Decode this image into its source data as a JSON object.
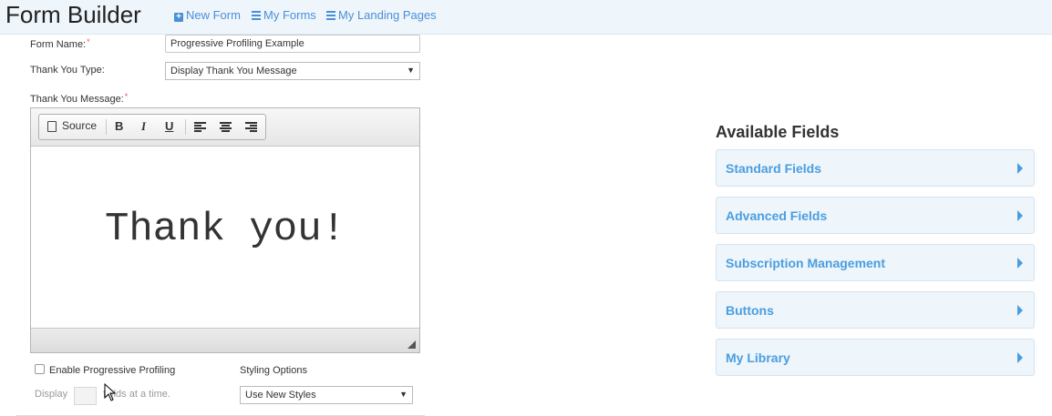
{
  "header": {
    "title": "Form Builder",
    "nav": [
      {
        "label": "New Form",
        "icon": "plus-square-icon"
      },
      {
        "label": "My Forms",
        "icon": "list-icon"
      },
      {
        "label": "My Landing Pages",
        "icon": "list-icon"
      }
    ]
  },
  "form": {
    "name_label": "Form Name:",
    "name_value": "Progressive Profiling Example",
    "thank_you_type_label": "Thank You Type:",
    "thank_you_type_value": "Display Thank You Message",
    "thank_you_message_label": "Thank You Message:",
    "required_mark": "*"
  },
  "editor": {
    "source_label": "Source",
    "bold": "B",
    "italic": "I",
    "underline": "U",
    "content": "Thank you!"
  },
  "options": {
    "progressive_label": "Enable Progressive Profiling",
    "display_prefix": "Display",
    "display_suffix": "fields at a time.",
    "styling_label": "Styling Options",
    "styling_value": "Use New Styles"
  },
  "available_fields": {
    "title": "Available Fields",
    "sections": [
      "Standard Fields",
      "Advanced Fields",
      "Subscription Management",
      "Buttons",
      "My Library"
    ]
  },
  "colors": {
    "accent": "#4a9ee0",
    "nav_link": "#4a90d9",
    "header_bg": "#eef5fb",
    "required": "#ee5555"
  }
}
